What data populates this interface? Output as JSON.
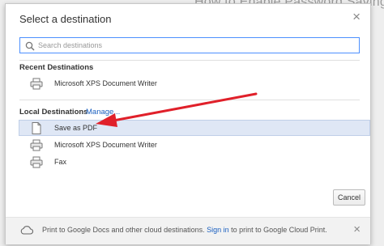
{
  "background": {
    "title": "How to Enable Password Saving in"
  },
  "dialog": {
    "title": "Select a destination",
    "close_glyph": "×",
    "search": {
      "placeholder": "Search destinations",
      "value": ""
    },
    "recent": {
      "heading": "Recent Destinations",
      "items": [
        {
          "label": "Microsoft XPS Document Writer",
          "icon": "printer-icon"
        }
      ]
    },
    "local": {
      "heading": "Local Destinations",
      "manage_label": "Manage...",
      "items": [
        {
          "label": "Save as PDF",
          "icon": "document-icon",
          "selected": true
        },
        {
          "label": "Microsoft XPS Document Writer",
          "icon": "printer-icon",
          "selected": false
        },
        {
          "label": "Fax",
          "icon": "printer-icon",
          "selected": false
        }
      ]
    },
    "cancel_label": "Cancel",
    "footer": {
      "text_before": "Print to Google Docs and other cloud destinations. ",
      "link": "Sign in",
      "text_after": " to print to Google Cloud Print.",
      "close_glyph": "×",
      "icon": "cloud-icon"
    }
  },
  "annotation": {
    "color": "#e0202a",
    "icon": "red-arrow"
  },
  "colors": {
    "accent": "#4d90fe",
    "selected_row": "#dfe7f5",
    "link": "#1a5fbf"
  }
}
